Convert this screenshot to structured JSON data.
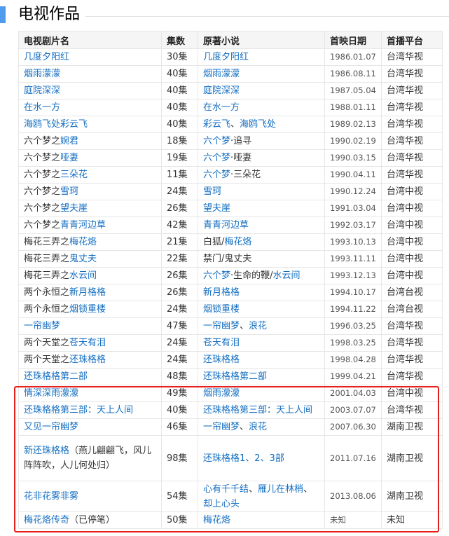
{
  "section": {
    "title": "电视作品"
  },
  "table": {
    "headers": [
      "电视剧片名",
      "集数",
      "原著小说",
      "首映日期",
      "首播平台"
    ],
    "rows": [
      {
        "title": [
          {
            "t": "几度夕阳红",
            "link": true
          }
        ],
        "episodes": "30集",
        "novel": [
          {
            "t": "几度夕阳红",
            "link": true
          }
        ],
        "date": "1986.01.07",
        "platform": "台湾华视"
      },
      {
        "title": [
          {
            "t": "烟雨濛濛",
            "link": true
          }
        ],
        "episodes": "40集",
        "novel": [
          {
            "t": "烟雨濛濛",
            "link": true
          }
        ],
        "date": "1986.08.11",
        "platform": "台湾华视"
      },
      {
        "title": [
          {
            "t": "庭院深深",
            "link": true
          }
        ],
        "episodes": "40集",
        "novel": [
          {
            "t": "庭院深深",
            "link": true
          }
        ],
        "date": "1987.05.04",
        "platform": "台湾华视"
      },
      {
        "title": [
          {
            "t": "在水一方",
            "link": true
          }
        ],
        "episodes": "40集",
        "novel": [
          {
            "t": "在水一方",
            "link": true
          }
        ],
        "date": "1988.01.11",
        "platform": "台湾华视"
      },
      {
        "title": [
          {
            "t": "海鸥飞处彩云飞",
            "link": true
          }
        ],
        "episodes": "40集",
        "novel": [
          {
            "t": "彩云飞",
            "link": true
          },
          {
            "t": "、",
            "link": false
          },
          {
            "t": "海鸥飞处",
            "link": true
          }
        ],
        "date": "1989.02.13",
        "platform": "台湾华视"
      },
      {
        "title": [
          {
            "t": "六个梦之",
            "link": false
          },
          {
            "t": "婉君",
            "link": true
          }
        ],
        "episodes": "18集",
        "novel": [
          {
            "t": "六个梦",
            "link": true
          },
          {
            "t": "·追寻",
            "link": false
          }
        ],
        "date": "1990.02.19",
        "platform": "台湾华视"
      },
      {
        "title": [
          {
            "t": "六个梦之",
            "link": false
          },
          {
            "t": "哑妻",
            "link": true
          }
        ],
        "episodes": "19集",
        "novel": [
          {
            "t": "六个梦",
            "link": true
          },
          {
            "t": "·哑妻",
            "link": false
          }
        ],
        "date": "1990.03.15",
        "platform": "台湾华视"
      },
      {
        "title": [
          {
            "t": "六个梦之",
            "link": false
          },
          {
            "t": "三朵花",
            "link": true
          }
        ],
        "episodes": "11集",
        "novel": [
          {
            "t": "六个梦",
            "link": true
          },
          {
            "t": "·三朵花",
            "link": false
          }
        ],
        "date": "1990.04.11",
        "platform": "台湾华视"
      },
      {
        "title": [
          {
            "t": "六个梦之",
            "link": false
          },
          {
            "t": "雪珂",
            "link": true
          }
        ],
        "episodes": "24集",
        "novel": [
          {
            "t": "雪珂",
            "link": true
          }
        ],
        "date": "1990.12.24",
        "platform": "台湾中视"
      },
      {
        "title": [
          {
            "t": "六个梦之",
            "link": false
          },
          {
            "t": "望夫崖",
            "link": true
          }
        ],
        "episodes": "26集",
        "novel": [
          {
            "t": "望夫崖",
            "link": true
          }
        ],
        "date": "1991.03.04",
        "platform": "台湾中视"
      },
      {
        "title": [
          {
            "t": "六个梦之",
            "link": false
          },
          {
            "t": "青青河边草",
            "link": true
          }
        ],
        "episodes": "42集",
        "novel": [
          {
            "t": "青青河边草",
            "link": true
          }
        ],
        "date": "1992.03.17",
        "platform": "台湾中视"
      },
      {
        "title": [
          {
            "t": "梅花三弄之",
            "link": false
          },
          {
            "t": "梅花烙",
            "link": true
          }
        ],
        "episodes": "21集",
        "novel": [
          {
            "t": "白狐/",
            "link": false
          },
          {
            "t": "梅花烙",
            "link": true
          }
        ],
        "date": "1993.10.13",
        "platform": "台湾中视"
      },
      {
        "title": [
          {
            "t": "梅花三弄之",
            "link": false
          },
          {
            "t": "鬼丈夫",
            "link": true
          }
        ],
        "episodes": "22集",
        "novel": [
          {
            "t": "禁门/鬼丈夫",
            "link": false
          }
        ],
        "date": "1993.11.11",
        "platform": "台湾中视"
      },
      {
        "title": [
          {
            "t": "梅花三弄之",
            "link": false
          },
          {
            "t": "水云间",
            "link": true
          }
        ],
        "episodes": "26集",
        "novel": [
          {
            "t": "六个梦",
            "link": true
          },
          {
            "t": "·生命的鞭/",
            "link": false
          },
          {
            "t": "水云间",
            "link": true
          }
        ],
        "date": "1993.12.13",
        "platform": "台湾中视"
      },
      {
        "title": [
          {
            "t": "两个永恒之",
            "link": false
          },
          {
            "t": "新月格格",
            "link": true
          }
        ],
        "episodes": "26集",
        "novel": [
          {
            "t": "新月格格",
            "link": true
          }
        ],
        "date": "1994.10.17",
        "platform": "台湾台视"
      },
      {
        "title": [
          {
            "t": "两个永恒之",
            "link": false
          },
          {
            "t": "烟锁重楼",
            "link": true
          }
        ],
        "episodes": "24集",
        "novel": [
          {
            "t": "烟锁重楼",
            "link": true
          }
        ],
        "date": "1994.11.22",
        "platform": "台湾台视"
      },
      {
        "title": [
          {
            "t": "一帘幽梦",
            "link": true
          }
        ],
        "episodes": "47集",
        "novel": [
          {
            "t": "一帘幽梦",
            "link": true
          },
          {
            "t": "、",
            "link": false
          },
          {
            "t": "浪花",
            "link": true
          }
        ],
        "date": "1996.03.25",
        "platform": "台湾华视"
      },
      {
        "title": [
          {
            "t": "两个天堂之",
            "link": false
          },
          {
            "t": "苍天有泪",
            "link": true
          }
        ],
        "episodes": "24集",
        "novel": [
          {
            "t": "苍天有泪",
            "link": true
          }
        ],
        "date": "1998.03.25",
        "platform": "台湾华视"
      },
      {
        "title": [
          {
            "t": "两个天堂之",
            "link": false
          },
          {
            "t": "还珠格格",
            "link": true
          }
        ],
        "episodes": "24集",
        "novel": [
          {
            "t": "还珠格格",
            "link": true
          }
        ],
        "date": "1998.04.28",
        "platform": "台湾华视"
      },
      {
        "title": [
          {
            "t": "还珠格格第二部",
            "link": true
          }
        ],
        "episodes": "48集",
        "novel": [
          {
            "t": "还珠格格第二部",
            "link": true
          }
        ],
        "date": "1999.04.21",
        "platform": "台湾华视"
      },
      {
        "title": [
          {
            "t": "情深深雨濛濛",
            "link": true
          }
        ],
        "episodes": "49集",
        "novel": [
          {
            "t": "烟雨濛濛",
            "link": true
          }
        ],
        "date": "2001.04.03",
        "platform": "台湾中视"
      },
      {
        "title": [
          {
            "t": "还珠格格第三部：天上人间",
            "link": true
          }
        ],
        "episodes": "40集",
        "novel": [
          {
            "t": "还珠格格第三部：天上人间",
            "link": true
          }
        ],
        "date": "2003.07.07",
        "platform": "台湾华视"
      },
      {
        "title": [
          {
            "t": "又见一帘幽梦",
            "link": true
          }
        ],
        "episodes": "46集",
        "novel": [
          {
            "t": "一帘幽梦",
            "link": true
          },
          {
            "t": "、",
            "link": false
          },
          {
            "t": "浪花",
            "link": true
          }
        ],
        "date": "2007.06.30",
        "platform": "湖南卫视"
      },
      {
        "title": [
          {
            "t": "新还珠格格",
            "link": true
          },
          {
            "t": "（燕儿翩翩飞，风儿阵阵吹，人儿何处归）",
            "link": false
          }
        ],
        "episodes": "98集",
        "novel": [
          {
            "t": "还珠格格1、2、3部",
            "link": true
          }
        ],
        "date": "2011.07.16",
        "platform": "湖南卫视",
        "size": "tall3"
      },
      {
        "title": [
          {
            "t": "花非花雾非雾",
            "link": true
          }
        ],
        "episodes": "54集",
        "novel": [
          {
            "t": "心有千千结",
            "link": true
          },
          {
            "t": "、",
            "link": false
          },
          {
            "t": "雁儿在林梢",
            "link": true
          },
          {
            "t": "、",
            "link": false
          },
          {
            "t": "却上心头",
            "link": true
          }
        ],
        "date": "2013.08.06",
        "platform": "湖南卫视",
        "size": "tall2"
      },
      {
        "title": [
          {
            "t": "梅花烙传奇",
            "link": true
          },
          {
            "t": "（已停笔）",
            "link": false
          }
        ],
        "episodes": "50集",
        "novel": [
          {
            "t": "梅花烙",
            "link": true
          }
        ],
        "date": "未知",
        "platform": "未知"
      }
    ]
  }
}
